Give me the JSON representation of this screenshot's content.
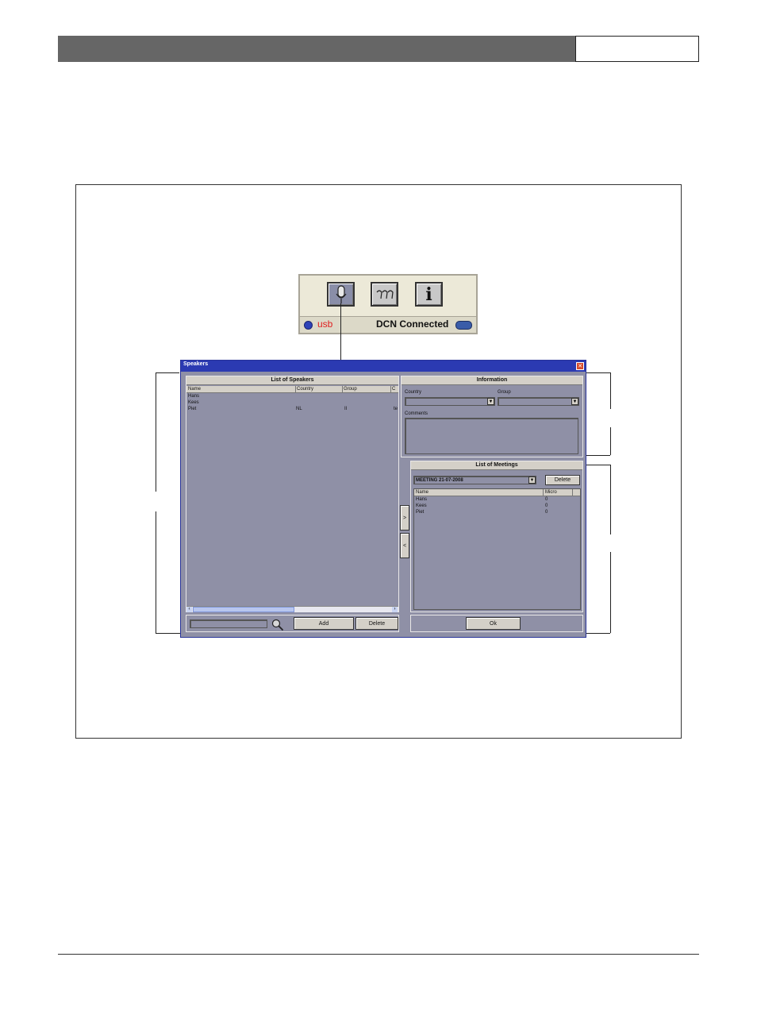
{
  "toolbar": {
    "mic_icon": "microphone-icon",
    "seats_icon": "delegates-icon",
    "info_icon": "info-icon",
    "info_glyph": "i",
    "usb_label": "usb",
    "dcn_label": "DCN Connected"
  },
  "window": {
    "title": "Speakers",
    "close_glyph": "✕",
    "speakers_panel": {
      "title": "List of Speakers",
      "columns": [
        "Name",
        "Country",
        "Group",
        "C"
      ],
      "rows": [
        [
          "Hans",
          "",
          "",
          ""
        ],
        [
          "Kees",
          "",
          "",
          ""
        ],
        [
          "Piet",
          "NL",
          "II",
          "te"
        ]
      ],
      "add_label": "Add",
      "delete_label": "Delete"
    },
    "info_panel": {
      "title": "Information",
      "country_label": "Country",
      "group_label": "Group",
      "comments_label": "Comments"
    },
    "move_right_label": ">",
    "move_left_label": "<",
    "meetings_panel": {
      "title": "List of Meetings",
      "selected_meeting": "MEETING 21-07-2008",
      "delete_label": "Delete",
      "columns": [
        "Name",
        "Micro"
      ],
      "rows": [
        [
          "Hans",
          "0"
        ],
        [
          "Kees",
          "0"
        ],
        [
          "Piet",
          "0"
        ]
      ],
      "ok_label": "Ok"
    }
  },
  "colors": {
    "header_bar": "#666666",
    "window_title": "#2b3ab2",
    "list_background": "#8f90a6"
  }
}
